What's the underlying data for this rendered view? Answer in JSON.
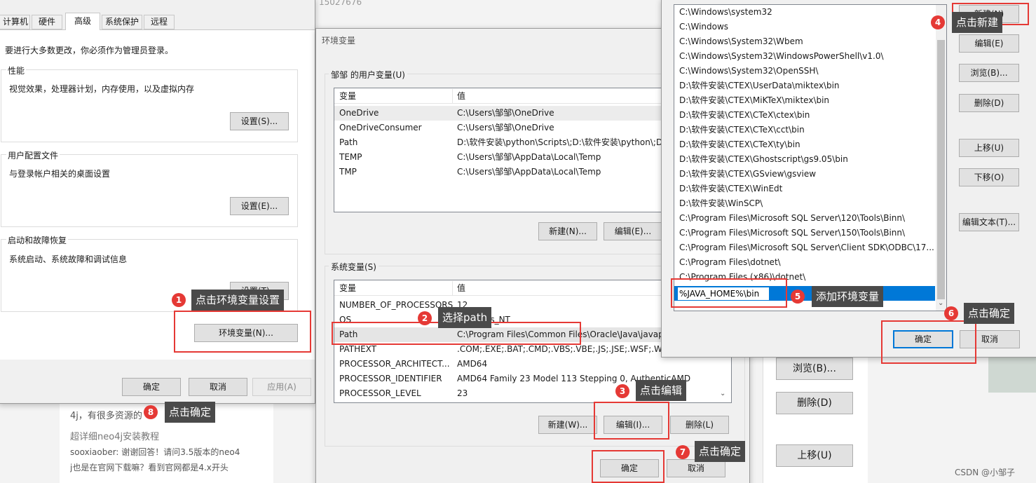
{
  "background": {
    "top_number": "15027676",
    "comment1": "4j，有很多资源的",
    "link": "超详细neo4j安装教程",
    "comment2": "sooxiaober: 谢谢回答！请问3.5版本的neo4",
    "comment3": "j也是在官网下载嘛？看到官网都是4.x开头",
    "right_buttons": [
      "浏览(B)...",
      "删除(D)",
      "上移(U)"
    ],
    "watermark": "CSDN @小邹子"
  },
  "sysprops": {
    "tabs": [
      "计算机名",
      "硬件",
      "高级",
      "系统保护",
      "远程"
    ],
    "active_tab": "高级",
    "admin_note": "要进行大多数更改，你必须作为管理员登录。",
    "performance": {
      "title": "性能",
      "desc": "视觉效果，处理器计划，内存使用，以及虚拟内存",
      "button": "设置(S)..."
    },
    "profile": {
      "title": "用户配置文件",
      "desc": "与登录帐户相关的桌面设置",
      "button": "设置(E)..."
    },
    "startup": {
      "title": "启动和故障恢复",
      "desc": "系统启动、系统故障和调试信息",
      "button": "设置(T)..."
    },
    "env_button": "环境变量(N)...",
    "ok": "确定",
    "cancel": "取消",
    "apply": "应用(A)"
  },
  "envvars": {
    "title": "环境变量",
    "user_group": "邹邹 的用户变量(U)",
    "col_var": "变量",
    "col_val": "值",
    "user_vars": [
      {
        "name": "OneDrive",
        "value": "C:\\Users\\邹邹\\OneDrive"
      },
      {
        "name": "OneDriveConsumer",
        "value": "C:\\Users\\邹邹\\OneDrive"
      },
      {
        "name": "Path",
        "value": "D:\\软件安装\\python\\Scripts\\;D:\\软件安装\\python\\;D:"
      },
      {
        "name": "TEMP",
        "value": "C:\\Users\\邹邹\\AppData\\Local\\Temp"
      },
      {
        "name": "TMP",
        "value": "C:\\Users\\邹邹\\AppData\\Local\\Temp"
      }
    ],
    "user_new": "新建(N)...",
    "user_edit": "编辑(E)...",
    "sys_group": "系统变量(S)",
    "sys_vars": [
      {
        "name": "NUMBER_OF_PROCESSORS",
        "value": "12"
      },
      {
        "name": "OS",
        "value": "Windows_NT"
      },
      {
        "name": "Path",
        "value": "C:\\Program Files\\Common Files\\Oracle\\Java\\javapath"
      },
      {
        "name": "PATHEXT",
        "value": ".COM;.EXE;.BAT;.CMD;.VBS;.VBE;.JS;.JSE;.WSF;.WSH"
      },
      {
        "name": "PROCESSOR_ARCHITECT...",
        "value": "AMD64"
      },
      {
        "name": "PROCESSOR_IDENTIFIER",
        "value": "AMD64 Family 23 Model 113 Stepping 0, AuthenticAMD"
      },
      {
        "name": "PROCESSOR_LEVEL",
        "value": "23"
      }
    ],
    "sys_new": "新建(W)...",
    "sys_edit": "编辑(I)...",
    "sys_delete": "删除(L)",
    "ok": "确定",
    "cancel": "取消"
  },
  "editpath": {
    "entries": [
      "C:\\Windows\\system32",
      "C:\\Windows",
      "C:\\Windows\\System32\\Wbem",
      "C:\\Windows\\System32\\WindowsPowerShell\\v1.0\\",
      "C:\\Windows\\System32\\OpenSSH\\",
      "D:\\软件安装\\CTEX\\UserData\\miktex\\bin",
      "D:\\软件安装\\CTEX\\MiKTeX\\miktex\\bin",
      "D:\\软件安装\\CTEX\\CTeX\\ctex\\bin",
      "D:\\软件安装\\CTEX\\CTeX\\cct\\bin",
      "D:\\软件安装\\CTEX\\CTeX\\ty\\bin",
      "D:\\软件安装\\CTEX\\Ghostscript\\gs9.05\\bin",
      "D:\\软件安装\\CTEX\\GSview\\gsview",
      "D:\\软件安装\\CTEX\\WinEdt",
      "D:\\软件安装\\WinSCP\\",
      "C:\\Program Files\\Microsoft SQL Server\\120\\Tools\\Binn\\",
      "C:\\Program Files\\Microsoft SQL Server\\150\\Tools\\Binn\\",
      "C:\\Program Files\\Microsoft SQL Server\\Client SDK\\ODBC\\17...",
      "C:\\Program Files\\dotnet\\",
      "C:\\Program Files (x86)\\dotnet\\"
    ],
    "new_entry": "%JAVA_HOME%\\bin",
    "buttons": {
      "new": "新建(N)",
      "edit": "编辑(E)",
      "browse": "浏览(B)...",
      "delete": "删除(D)",
      "up": "上移(U)",
      "down": "下移(O)",
      "edit_text": "编辑文本(T)..."
    },
    "ok": "确定",
    "cancel": "取消"
  },
  "annotations": [
    {
      "num": "1",
      "text": "点击环境变量设置"
    },
    {
      "num": "2",
      "text": "选择path"
    },
    {
      "num": "3",
      "text": "点击编辑"
    },
    {
      "num": "4",
      "text": "点击新建"
    },
    {
      "num": "5",
      "text": "添加环境变量"
    },
    {
      "num": "6",
      "text": "点击确定"
    },
    {
      "num": "7",
      "text": "点击确定"
    },
    {
      "num": "8",
      "text": "点击确定"
    }
  ],
  "colors": {
    "annotation_red": "#e53935",
    "tooltip_bg": "#4a4a4a",
    "selection_blue": "#0078d7"
  }
}
